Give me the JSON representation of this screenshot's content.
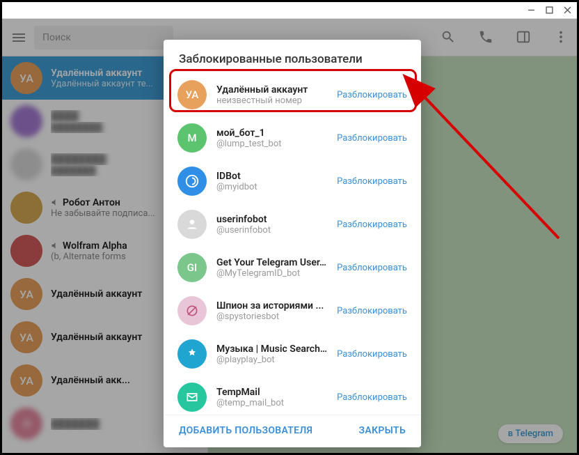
{
  "window": {
    "title": ""
  },
  "topbar": {
    "search_placeholder": "Поиск"
  },
  "chats": [
    {
      "name": "Удалённый аккаунт",
      "sub": "Удалённый аккаунт те...",
      "avatar_text": "УА",
      "avatar_class": "c-orange",
      "selected": true,
      "blurred": false,
      "speaker": false
    },
    {
      "name": "████",
      "sub": "████████",
      "avatar_text": "",
      "avatar_class": "c-purple",
      "selected": false,
      "blurred": true,
      "speaker": false
    },
    {
      "name": "████████",
      "sub": "███████",
      "avatar_text": "",
      "avatar_class": "c-grey",
      "selected": false,
      "blurred": true,
      "speaker": false
    },
    {
      "name": "Робот Антон",
      "sub": "Не забывайте подписа...",
      "avatar_text": "",
      "avatar_class": "c-gold",
      "selected": false,
      "blurred": false,
      "speaker": true
    },
    {
      "name": "Wolfram Alpha",
      "sub": "(b, Alternate forms",
      "avatar_text": "",
      "avatar_class": "c-red",
      "selected": false,
      "blurred": false,
      "speaker": true
    },
    {
      "name": "Удалённый аккаунт",
      "sub": "",
      "avatar_text": "УА",
      "avatar_class": "c-orange",
      "selected": false,
      "blurred": false,
      "speaker": false
    },
    {
      "name": "Удалённый аккаунт",
      "sub": "",
      "avatar_text": "УА",
      "avatar_class": "c-orange",
      "selected": false,
      "blurred": false,
      "speaker": false
    },
    {
      "name": "Удалённый акк...",
      "sub": "",
      "avatar_text": "УА",
      "avatar_class": "c-orange",
      "selected": false,
      "blurred": false,
      "speaker": false
    },
    {
      "name": "███████",
      "sub": "",
      "avatar_text": "Л",
      "avatar_class": "c-pink",
      "selected": false,
      "blurred": true,
      "speaker": false
    }
  ],
  "chatpanel": {
    "join_label": "в Telegram"
  },
  "modal": {
    "title": "Заблокированные пользователи",
    "unblock_label": "Разблокировать",
    "add_label": "ДОБАВИТЬ ПОЛЬЗОВАТЕЛЯ",
    "close_label": "ЗАКРЫТЬ",
    "items": [
      {
        "name": "Удалённый аккаунт",
        "sub": "неизвестный номер",
        "avatar_text": "УА",
        "avatar_class": "c-orange"
      },
      {
        "name": "мой_бот_1",
        "sub": "@lump_test_bot",
        "avatar_text": "М",
        "avatar_class": "c-green"
      },
      {
        "name": "IDBot",
        "sub": "@myidbot",
        "avatar_text": "",
        "avatar_class": "c-blue"
      },
      {
        "name": "userinfobot",
        "sub": "@userinfobot",
        "avatar_text": "",
        "avatar_class": "c-grey"
      },
      {
        "name": "Get Your Telegram User...",
        "sub": "@MyTelegramID_bot",
        "avatar_text": "GI",
        "avatar_class": "c-lime"
      },
      {
        "name": "Шпион за историями ...",
        "sub": "@spystoriesbot",
        "avatar_text": "",
        "avatar_class": "c-pinkish"
      },
      {
        "name": "Музыка | Music Search...",
        "sub": "@playplay_bot",
        "avatar_text": "",
        "avatar_class": "c-teal"
      },
      {
        "name": "TempMail",
        "sub": "@temp_mail_bot",
        "avatar_text": "",
        "avatar_class": "c-mint"
      }
    ]
  }
}
